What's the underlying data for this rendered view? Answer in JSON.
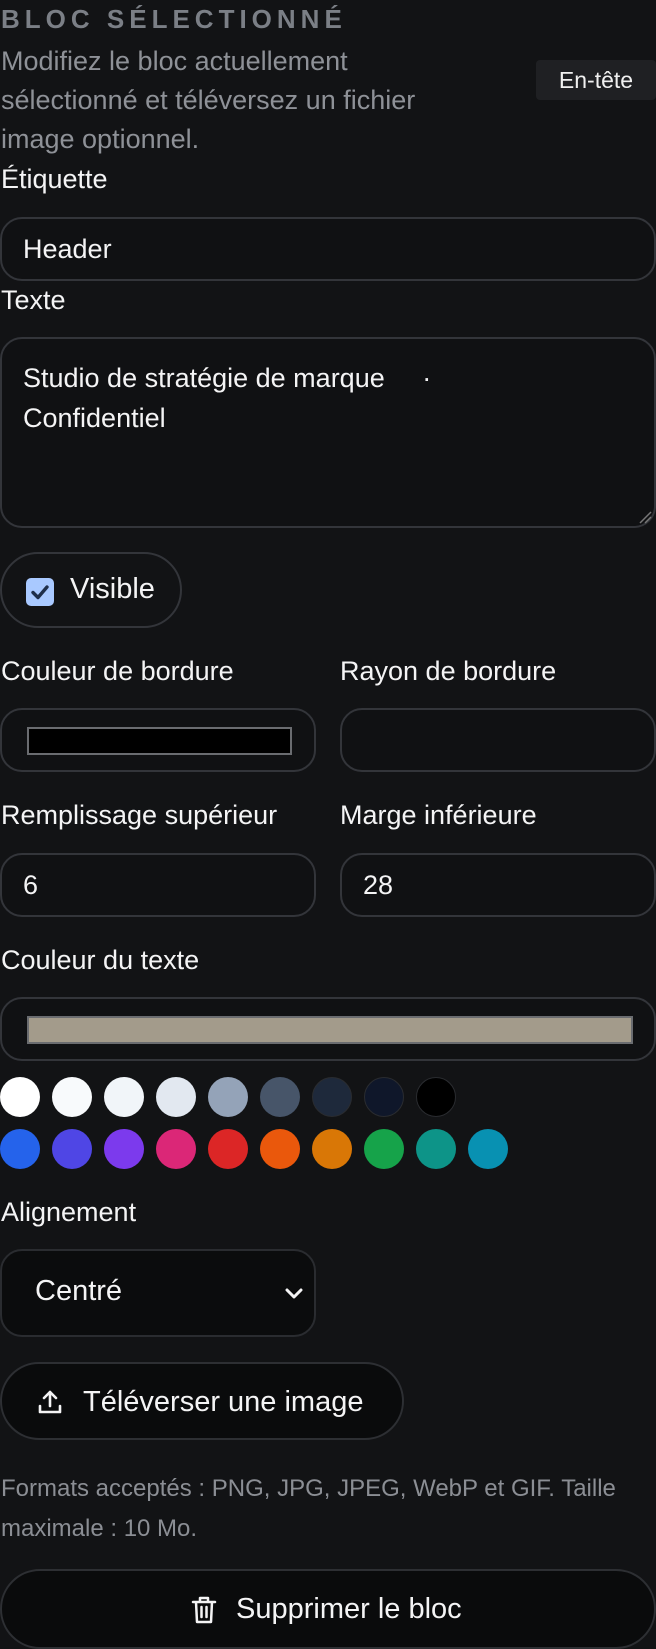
{
  "section": {
    "title": "BLOC SÉLECTIONNÉ",
    "description": "Modifiez le bloc actuellement sélectionné et téléversez un fichier image optionnel.",
    "badge": "En-tête"
  },
  "fields": {
    "label": {
      "title": "Étiquette",
      "value": "Header"
    },
    "text": {
      "title": "Texte",
      "value": "Studio de stratégie de marque     ·\nConfidentiel"
    },
    "visible": {
      "label": "Visible",
      "checked": true
    },
    "border_color": {
      "title": "Couleur de bordure",
      "value": "#000000"
    },
    "border_radius": {
      "title": "Rayon de bordure",
      "value": ""
    },
    "padding_top": {
      "title": "Remplissage supérieur",
      "value": "6"
    },
    "margin_bottom": {
      "title": "Marge inférieure",
      "value": "28"
    },
    "text_color": {
      "title": "Couleur du texte",
      "value": "#a39b8b"
    },
    "alignment": {
      "title": "Alignement",
      "value": "Centré"
    }
  },
  "palette": {
    "row1": [
      "#ffffff",
      "#f8fafc",
      "#f1f5f9",
      "#e2e8f0",
      "#94a3b8",
      "#475569",
      "#1e293b",
      "#0f172a",
      "#000000"
    ],
    "row2": [
      "#2563eb",
      "#4f46e5",
      "#7c3aed",
      "#db2777",
      "#dc2626",
      "#ea580c",
      "#d97706",
      "#16a34a",
      "#0d9488",
      "#0891b2"
    ]
  },
  "upload": {
    "button_label": "Téléverser une image",
    "icon": "upload-icon",
    "hint": "Formats acceptés : PNG, JPG, JPEG, WebP et GIF. Taille maximale : 10 Mo."
  },
  "delete": {
    "button_label": "Supprimer le bloc",
    "icon": "trash-icon"
  }
}
